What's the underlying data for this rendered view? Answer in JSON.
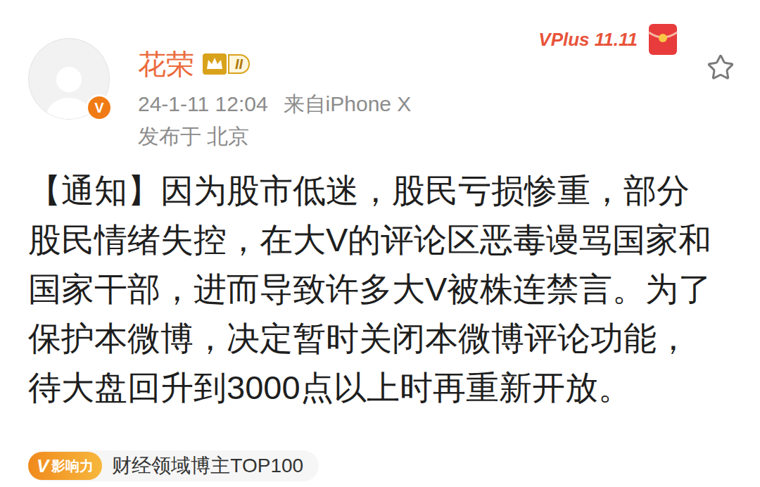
{
  "post": {
    "author": {
      "name": "花荣",
      "level": "II",
      "verified_mark": "V"
    },
    "time": "24-1-11 12:04",
    "source": "来自iPhone X",
    "location": "发布于 北京",
    "body_lines": [
      "【通知】因为股市低迷，股民亏损惨重，部分",
      "股民情绪失控，在大V的评论区恶毒谩骂国家和",
      "国家干部，进而导致许多大V被株连禁言。为了",
      "保护本微博，决定暂时关闭本微博评论功能，",
      "待大盘回升到3000点以上时再重新开放。"
    ],
    "influence": {
      "mark": "V",
      "label": "影响力",
      "text": "财经领域博主TOP100"
    }
  },
  "promo": {
    "text": "VPlus 11.11"
  },
  "favorite": {
    "selected": false
  }
}
